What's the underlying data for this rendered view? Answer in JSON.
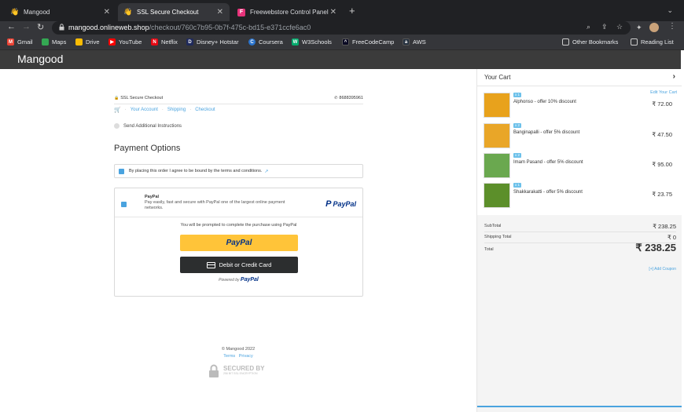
{
  "browser": {
    "tabs": [
      {
        "title": "Mangood",
        "active": false
      },
      {
        "title": "SSL Secure Checkout",
        "active": true
      },
      {
        "title": "Freewebstore Control Panel",
        "active": false
      }
    ],
    "url_host": "mangood.onlineweb.shop",
    "url_path": "/checkout/760c7b95-0b7f-475c-bd15-e371ccfe6ac0",
    "bookmarks": [
      {
        "label": "Gmail",
        "icon": "gmail-icon",
        "color": "#ea4335"
      },
      {
        "label": "Maps",
        "icon": "maps-icon",
        "color": "#34a853"
      },
      {
        "label": "Drive",
        "icon": "drive-icon",
        "color": "#fbbc04"
      },
      {
        "label": "YouTube",
        "icon": "youtube-icon",
        "color": "#ff0000"
      },
      {
        "label": "Netflix",
        "icon": "netflix-icon",
        "color": "#e50914"
      },
      {
        "label": "Disney+ Hotstar",
        "icon": "hotstar-icon",
        "color": "#1f2a5c"
      },
      {
        "label": "Coursera",
        "icon": "coursera-icon",
        "color": "#2a73cc"
      },
      {
        "label": "W3Schools",
        "icon": "w3schools-icon",
        "color": "#04aa6d"
      },
      {
        "label": "FreeCodeCamp",
        "icon": "freecodecamp-icon",
        "color": "#0a0a23"
      },
      {
        "label": "AWS",
        "icon": "aws-icon",
        "color": "#232f3e"
      }
    ],
    "other_bookmarks": "Other Bookmarks",
    "reading_list": "Reading List"
  },
  "site": {
    "brand": "Mangood"
  },
  "checkout": {
    "ssl_label": "SSL Secure Checkout",
    "phone": "8688395961",
    "breadcrumbs": [
      "Your Account",
      "Shipping",
      "Checkout"
    ],
    "additional_instructions": "Send Additional Instructions",
    "payment_title": "Payment Options",
    "terms_text": "By placing this order I agree to be bound by the terms and conditions.",
    "paypal": {
      "name": "PayPal",
      "description": "Pay easily, fast and secure with PayPal one of the largest online payment networks.",
      "logo_text": "PayPal",
      "prompt": "You will be prompted to complete the purchase using PayPal",
      "button_label": "PayPal",
      "card_button_label": "Debit or Credit Card",
      "powered_by": "Powered by",
      "powered_brand": "PayPal"
    }
  },
  "footer": {
    "copyright": "© Mangood 2022",
    "terms": "Terms",
    "privacy": "Privacy",
    "secured_by": "SECURED BY",
    "encryption": "256 BIT SSL ENCRYPTION"
  },
  "cart": {
    "title": "Your Cart",
    "edit_label": "Edit Your Cart",
    "items": [
      {
        "qty": "x 1",
        "name": "Alphonso - offer 10% discount",
        "price": "₹ 72.00",
        "color": "#e8a21c"
      },
      {
        "qty": "x 2",
        "name": "Banginapalli - offer 5% discount",
        "price": "₹ 47.50",
        "color": "#e9a628"
      },
      {
        "qty": "x 2",
        "name": "Imam Pasand - offer 5% discount",
        "price": "₹ 95.00",
        "color": "#6aa84f"
      },
      {
        "qty": "x 1",
        "name": "Shakkarakatti - offer 5% discount",
        "price": "₹ 23.75",
        "color": "#5c8f2a"
      }
    ],
    "subtotal_label": "SubTotal",
    "subtotal": "₹ 238.25",
    "shipping_label": "Shipping Total",
    "shipping": "₹ 0",
    "total_label": "Total",
    "total": "₹ 238.25",
    "coupon": "[+] Add Coupon"
  }
}
